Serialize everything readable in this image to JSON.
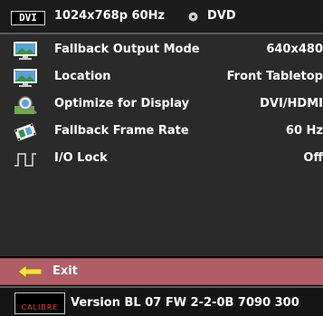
{
  "header": {
    "input_badge": "DVI",
    "resolution": "1024x768p 60Hz",
    "source": "DVD"
  },
  "menu": {
    "items": [
      {
        "label": "Fallback Output Mode",
        "value": "640x480",
        "icon": "monitor-landscape-icon"
      },
      {
        "label": "Location",
        "value": "Front Tabletop",
        "icon": "monitor-landscape-icon"
      },
      {
        "label": "Optimize for Display",
        "value": "DVI/HDMI",
        "icon": "optimize-display-icon"
      },
      {
        "label": "Fallback Frame Rate",
        "value": "60 Hz",
        "icon": "film-frame-icon"
      },
      {
        "label": "I/O Lock",
        "value": "Off",
        "icon": "io-signal-icon"
      }
    ]
  },
  "exit": {
    "label": "Exit",
    "icon": "back-arrow-icon"
  },
  "footer": {
    "logo_text": "CALIBRE",
    "version": "Version BL 07 FW 2-2-0B 7090 300"
  },
  "colors": {
    "background": "#000000",
    "menu_panel": "#2a2a2a",
    "exit_highlight": "#b25c66",
    "text": "#ffffff"
  }
}
